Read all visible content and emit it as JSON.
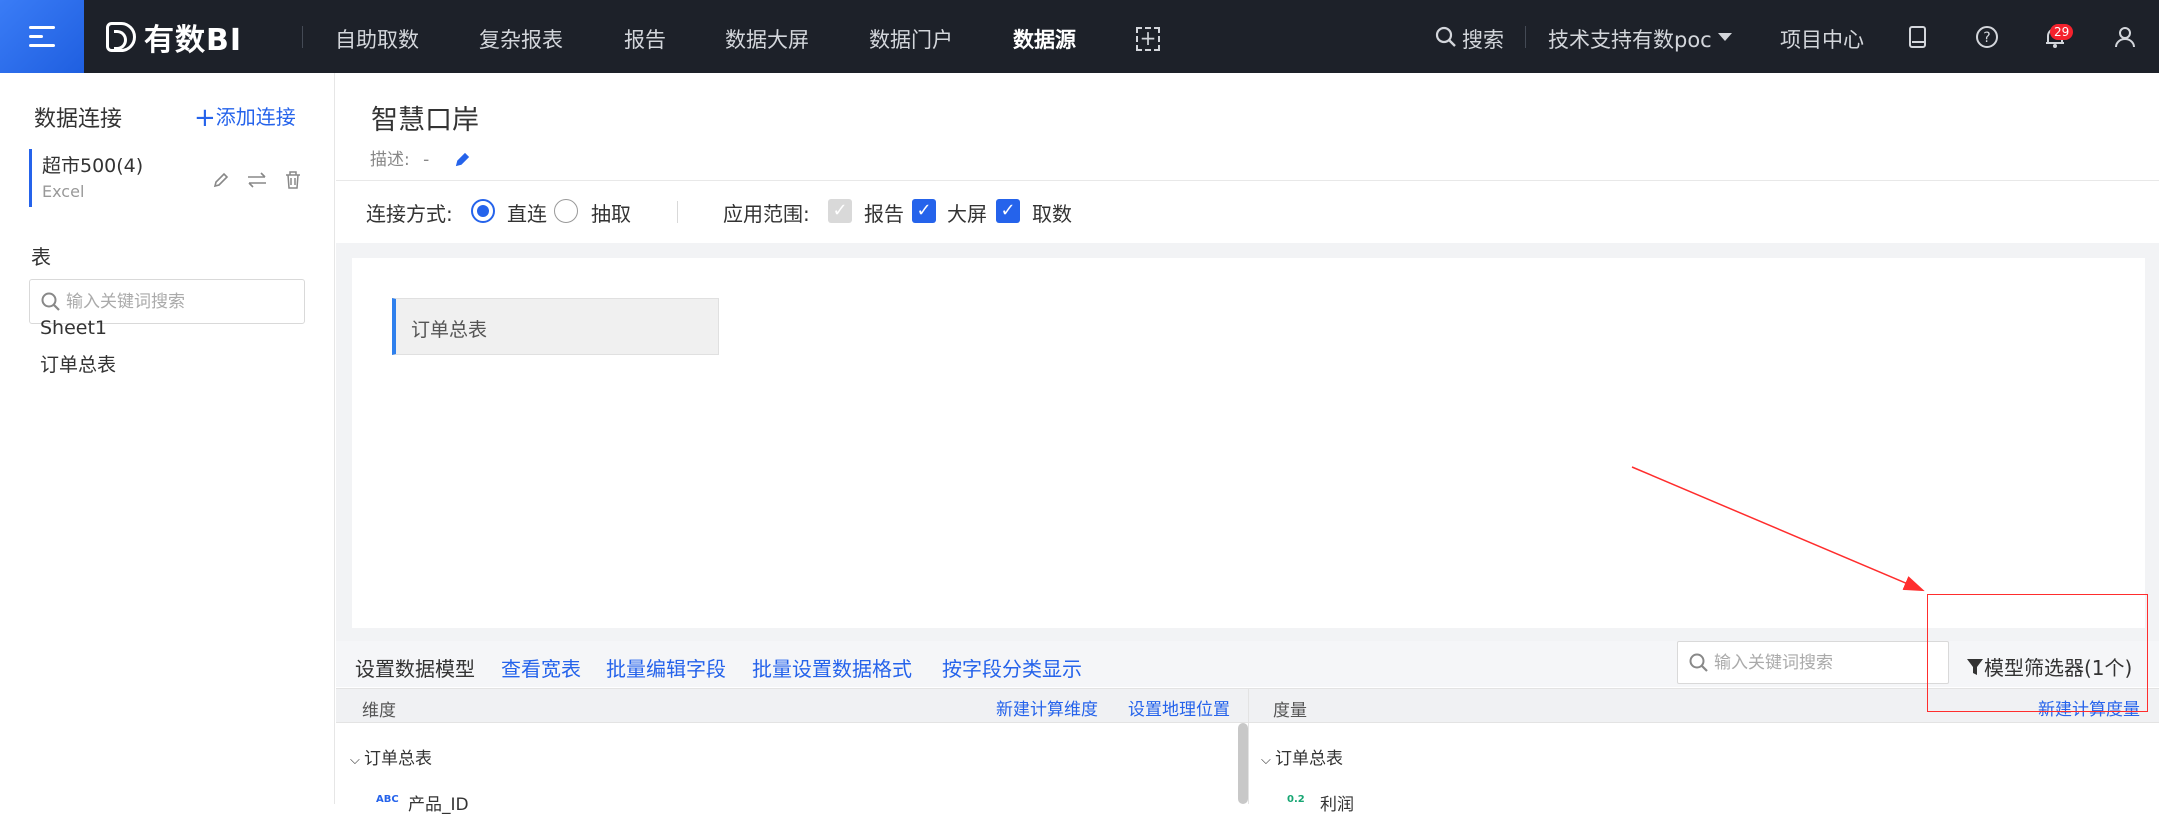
{
  "topbar": {
    "logo_text": "有数BI",
    "nav": [
      "自助取数",
      "复杂报表",
      "报告",
      "数据大屏",
      "数据门户",
      "数据源"
    ],
    "active_nav": "数据源",
    "search_label": "搜索",
    "project_label": "技术支持有数poc",
    "project_center": "项目中心",
    "notification_count": "29"
  },
  "sidebar": {
    "title": "数据连接",
    "add_label": "添加连接",
    "connection": {
      "name": "超市500(4)",
      "type": "Excel"
    },
    "table_section": "表",
    "search_placeholder": "输入关键词搜索",
    "tables": [
      "Sheet1",
      "订单总表"
    ]
  },
  "main": {
    "title": "智慧口岸",
    "desc_label": "描述:",
    "desc_value": "-",
    "connect_mode_label": "连接方式:",
    "modes": [
      "直连",
      "抽取"
    ],
    "selected_mode": "直连",
    "scope_label": "应用范围:",
    "scopes": [
      {
        "label": "报告",
        "checked": true,
        "disabled": true
      },
      {
        "label": "大屏",
        "checked": true,
        "disabled": false
      },
      {
        "label": "取数",
        "checked": true,
        "disabled": false
      }
    ],
    "canvas_table": "订单总表"
  },
  "toolbar": {
    "model_label": "设置数据模型",
    "links": [
      "查看宽表",
      "批量编辑字段",
      "批量设置数据格式",
      "按字段分类显示"
    ],
    "search_placeholder": "输入关键词搜索",
    "filter_label": "模型筛选器(1个)"
  },
  "dimensions": {
    "title": "维度",
    "links": [
      "新建计算维度",
      "设置地理位置"
    ],
    "group": "订单总表",
    "field_type": "ABC",
    "field": "产品_ID"
  },
  "measures": {
    "title": "度量",
    "link": "新建计算度量",
    "group": "订单总表",
    "field_type": "0.2",
    "field": "利润"
  },
  "colors": {
    "accent": "#2563eb",
    "topbar": "#1d2129",
    "annotation": "#ff2d2d"
  }
}
